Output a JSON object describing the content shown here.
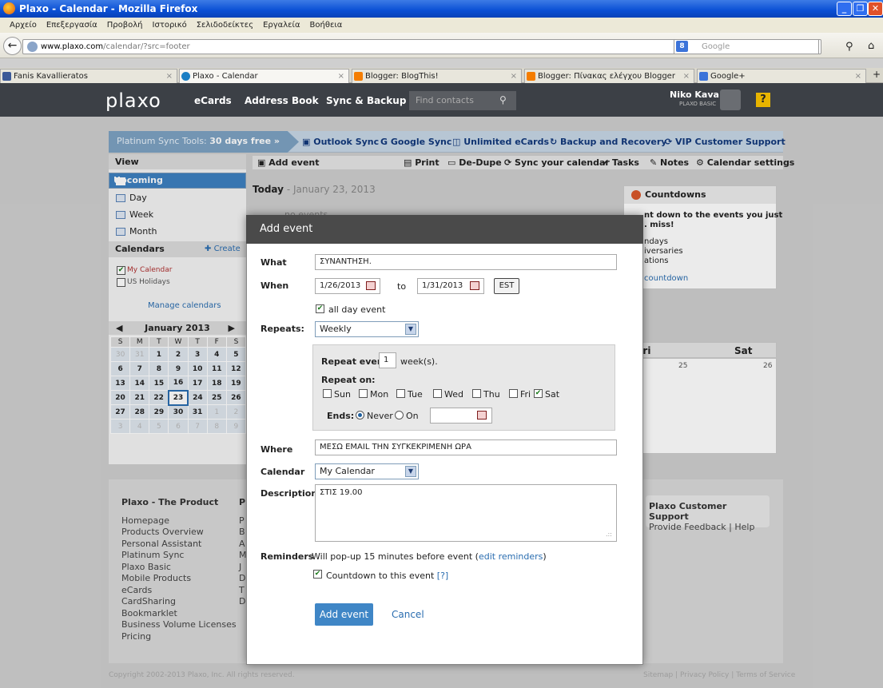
{
  "window": {
    "title": "Plaxo - Calendar - Mozilla Firefox"
  },
  "menu": [
    "Αρχείο",
    "Επεξεργασία",
    "Προβολή",
    "Ιστορικό",
    "Σελιδοδείκτες",
    "Εργαλεία",
    "Βοήθεια"
  ],
  "url": {
    "host": "www.plaxo.com",
    "path": "/calendar/?src=footer"
  },
  "google_search": {
    "placeholder": "Google"
  },
  "tabs": [
    "Fanis Kavallieratos",
    "Plaxo - Calendar",
    "Blogger: BlogThis!",
    "Blogger: Πίνακας ελέγχου Blogger",
    "Google+"
  ],
  "header": {
    "logo": "plaxo",
    "nav": [
      "eCards",
      "Address Book",
      "Sync & Backup"
    ],
    "find_placeholder": "Find contacts",
    "user": "Niko Kava",
    "plan": "PLAXO BASIC",
    "help": "?"
  },
  "promo": {
    "lead": "Platinum Sync Tools:",
    "offer": "30 days free »",
    "items": [
      "Outlook Sync",
      "Google Sync",
      "Unlimited eCards",
      "Backup and Recovery",
      "VIP Customer Support"
    ]
  },
  "sidebar": {
    "view_title": "View",
    "views": [
      "Upcoming",
      "Day",
      "Week",
      "Month"
    ],
    "calendars_title": "Calendars",
    "create": "Create",
    "calendars": [
      {
        "name": "My Calendar",
        "checked": "✔"
      },
      {
        "name": "US Holidays",
        "checked": ""
      }
    ],
    "manage": "Manage calendars"
  },
  "minical": {
    "month": "January 2013",
    "prev": "◀",
    "next": "▶",
    "weekdays": [
      "S",
      "M",
      "T",
      "W",
      "T",
      "F",
      "S"
    ],
    "weeks": [
      [
        "30",
        "31",
        "1",
        "2",
        "3",
        "4",
        "5"
      ],
      [
        "6",
        "7",
        "8",
        "9",
        "10",
        "11",
        "12"
      ],
      [
        "13",
        "14",
        "15",
        "16",
        "17",
        "18",
        "19"
      ],
      [
        "20",
        "21",
        "22",
        "23",
        "24",
        "25",
        "26"
      ],
      [
        "27",
        "28",
        "29",
        "30",
        "31",
        "1",
        "2"
      ],
      [
        "3",
        "4",
        "5",
        "6",
        "7",
        "8",
        "9"
      ]
    ]
  },
  "toolbar": {
    "add": "Add event",
    "items": [
      "Print",
      "De-Dupe",
      "Sync your calendar",
      "Tasks",
      "Notes",
      "Calendar settings"
    ]
  },
  "today": {
    "label": "Today",
    "date": "- January 23, 2013",
    "noevents": "no events"
  },
  "countdowns": {
    "title": "Countdowns",
    "text1": "nt down to the events you just",
    "text2": ". miss!",
    "l1": "ndays",
    "l2": "iversaries",
    "l3": "ations",
    "link": "countdown"
  },
  "week": {
    "fri": "Fri",
    "sat": "Sat",
    "d25": "25",
    "d26": "26"
  },
  "footer": {
    "col1_title": "Plaxo - The Product",
    "col2_title": "P",
    "links": [
      "Homepage",
      "Products Overview",
      "Personal Assistant",
      "Platinum Sync",
      "Plaxo Basic",
      "Mobile Products",
      "eCards",
      "CardSharing",
      "Bookmarklet",
      "Business Volume Licenses",
      "Pricing"
    ],
    "col2_letters": [
      "P",
      "B",
      "A",
      "M",
      "J",
      "D",
      "T",
      "D"
    ],
    "support_title": "Plaxo Customer Support",
    "support_links": "Provide Feedback | Help",
    "copyright": "Copyright 2002-2013 Plaxo, Inc. All rights reserved.",
    "bottom_links": "Sitemap | Privacy Policy | Terms of Service"
  },
  "modal": {
    "title": "Add event",
    "what_label": "What",
    "what_value": "ΣΥΝΑΝΤΗΣΗ.",
    "when_label": "When",
    "start": "1/26/2013",
    "to": "to",
    "end": "1/31/2013",
    "tz": "EST",
    "allday": "all day event",
    "repeats_label": "Repeats:",
    "repeats": "Weekly",
    "every_label": "Repeat every:",
    "every_value": "1",
    "every_unit": "week(s).",
    "on_label": "Repeat on:",
    "days": [
      {
        "d": "Sun",
        "c": ""
      },
      {
        "d": "Mon",
        "c": ""
      },
      {
        "d": "Tue",
        "c": ""
      },
      {
        "d": "Wed",
        "c": ""
      },
      {
        "d": "Thu",
        "c": ""
      },
      {
        "d": "Fri",
        "c": ""
      },
      {
        "d": "Sat",
        "c": "✔"
      }
    ],
    "ends_label": "Ends:",
    "never": "Never",
    "on": "On",
    "where_label": "Where",
    "where_value": "ΜΕΣΩ EMAIL ΤΗΝ ΣΥΓΚΕΚΡΙΜΕΝΗ ΩΡΑ",
    "calendar_label": "Calendar",
    "calendar_value": "My Calendar",
    "desc_label": "Description",
    "desc_value": "ΣΤΙΣ 19.00",
    "rem_label": "Reminders",
    "rem_text": "Will pop-up 15 minutes before event (",
    "rem_link": "edit reminders",
    "rem_close": ")",
    "countdown_text": "Countdown to this event",
    "countdown_help": "[?]",
    "add_btn": "Add event",
    "cancel": "Cancel"
  }
}
